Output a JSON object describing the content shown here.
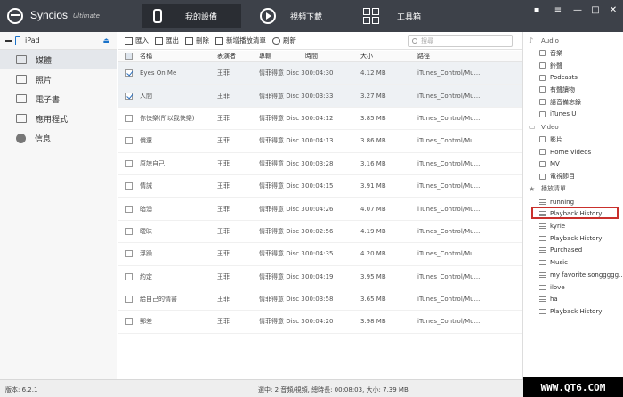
{
  "app": {
    "name": "Syncios",
    "edition": "Ultimate"
  },
  "nav": [
    {
      "label": "我的設備",
      "icon": "phone-icon",
      "active": true
    },
    {
      "label": "視頻下載",
      "icon": "play-icon",
      "active": false
    },
    {
      "label": "工具箱",
      "icon": "toolbox-icon",
      "active": false
    }
  ],
  "window_controls": [
    "chat-icon",
    "menu-icon",
    "minimize-icon",
    "maximize-icon",
    "close-icon"
  ],
  "device": {
    "name": "iPad"
  },
  "sidebar": [
    {
      "label": "媒體",
      "icon": "media-icon",
      "active": true
    },
    {
      "label": "照片",
      "icon": "photos-icon",
      "active": false
    },
    {
      "label": "電子書",
      "icon": "ebook-icon",
      "active": false
    },
    {
      "label": "應用程式",
      "icon": "apps-icon",
      "active": false
    },
    {
      "label": "信息",
      "icon": "info-icon",
      "active": false
    }
  ],
  "toolbar": {
    "import": "匯入",
    "export": "匯出",
    "delete": "刪除",
    "new_playlist": "新增播放清單",
    "refresh": "刷新",
    "search_placeholder": "搜尋"
  },
  "table": {
    "headers": {
      "name": "名稱",
      "artist": "表演者",
      "album": "專輯",
      "time": "時間",
      "size": "大小",
      "path": "路徑"
    },
    "rows": [
      {
        "checked": true,
        "name": "Eyes On Me",
        "artist": "王菲",
        "album": "情菲得意 Disc 3",
        "time": "00:04:30",
        "size": "4.12 MB",
        "path": "iTunes_Control/Mu..."
      },
      {
        "checked": true,
        "name": "人間",
        "artist": "王菲",
        "album": "情菲得意 Disc 3",
        "time": "00:03:33",
        "size": "3.27 MB",
        "path": "iTunes_Control/Mu..."
      },
      {
        "checked": false,
        "name": "你快樂(所以我快樂)",
        "artist": "王菲",
        "album": "情菲得意 Disc 3",
        "time": "00:04:12",
        "size": "3.85 MB",
        "path": "iTunes_Control/Mu..."
      },
      {
        "checked": false,
        "name": "償還",
        "artist": "王菲",
        "album": "情菲得意 Disc 3",
        "time": "00:04:13",
        "size": "3.86 MB",
        "path": "iTunes_Control/Mu..."
      },
      {
        "checked": false,
        "name": "原諒自己",
        "artist": "王菲",
        "album": "情菲得意 Disc 3",
        "time": "00:03:28",
        "size": "3.16 MB",
        "path": "iTunes_Control/Mu..."
      },
      {
        "checked": false,
        "name": "情誡",
        "artist": "王菲",
        "album": "情菲得意 Disc 3",
        "time": "00:04:15",
        "size": "3.91 MB",
        "path": "iTunes_Control/Mu..."
      },
      {
        "checked": false,
        "name": "暗湧",
        "artist": "王菲",
        "album": "情菲得意 Disc 3",
        "time": "00:04:26",
        "size": "4.07 MB",
        "path": "iTunes_Control/Mu..."
      },
      {
        "checked": false,
        "name": "曖昧",
        "artist": "王菲",
        "album": "情菲得意 Disc 3",
        "time": "00:02:56",
        "size": "4.19 MB",
        "path": "iTunes_Control/Mu..."
      },
      {
        "checked": false,
        "name": "浮躁",
        "artist": "王菲",
        "album": "情菲得意 Disc 3",
        "time": "00:04:35",
        "size": "4.20 MB",
        "path": "iTunes_Control/Mu..."
      },
      {
        "checked": false,
        "name": "約定",
        "artist": "王菲",
        "album": "情菲得意 Disc 3",
        "time": "00:04:19",
        "size": "3.95 MB",
        "path": "iTunes_Control/Mu..."
      },
      {
        "checked": false,
        "name": "給自己的情書",
        "artist": "王菲",
        "album": "情菲得意 Disc 3",
        "time": "00:03:58",
        "size": "3.65 MB",
        "path": "iTunes_Control/Mu..."
      },
      {
        "checked": false,
        "name": "郵差",
        "artist": "王菲",
        "album": "情菲得意 Disc 3",
        "time": "00:04:20",
        "size": "3.98 MB",
        "path": "iTunes_Control/Mu..."
      }
    ]
  },
  "rpanel": {
    "audio_label": "Audio",
    "audio": [
      "音樂",
      "鈴聲",
      "Podcasts",
      "有聲讀物",
      "語音備忘錄",
      "iTunes U"
    ],
    "video_label": "Video",
    "video": [
      "影片",
      "Home Videos",
      "MV",
      "電視節目"
    ],
    "playlists_label": "播放清單",
    "playlists": [
      "running",
      "Playback History",
      "kyrie",
      "Playback History",
      "Purchased",
      "Music",
      "my favorite songgggg...",
      "ilove",
      "ha",
      "Playback History"
    ],
    "highlight_color": "#c9302c"
  },
  "status": {
    "version": "版本: 6.2.1",
    "selection": "選中: 2 音頻/視頻, 總時長: 00:08:03, 大小: 7.39 MB"
  },
  "watermark": "WWW.QT6.COM"
}
